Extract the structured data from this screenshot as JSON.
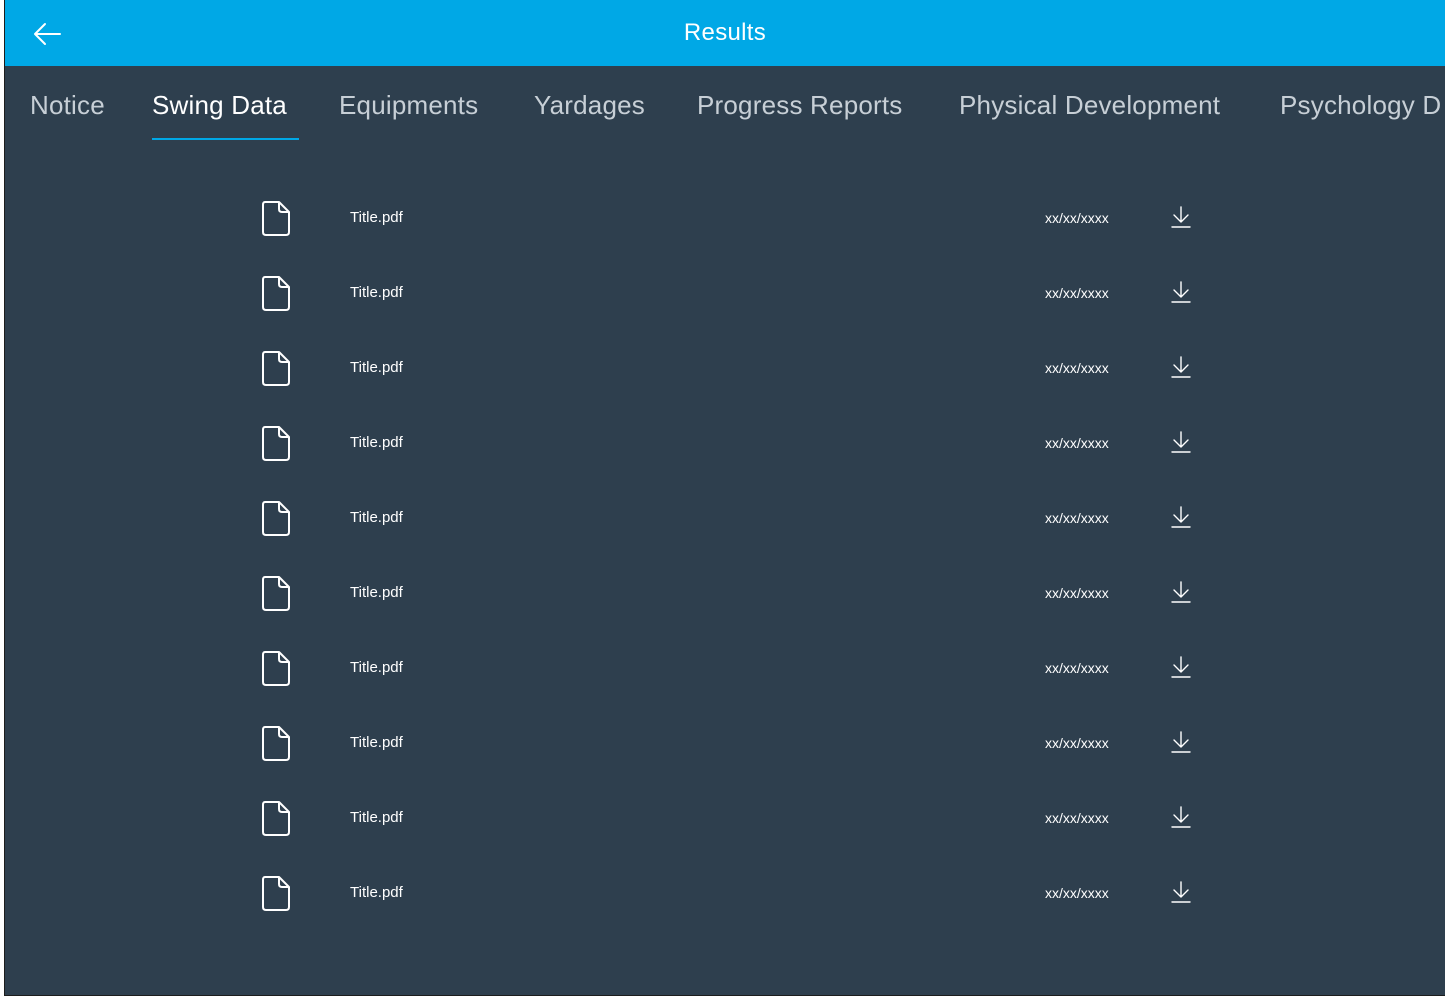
{
  "header": {
    "title": "Results",
    "back_icon": "arrow-left-icon",
    "background": "#00a8e6"
  },
  "tabs": [
    {
      "label": "Notice",
      "active": false
    },
    {
      "label": "Swing Data",
      "active": true
    },
    {
      "label": "Equipments",
      "active": false
    },
    {
      "label": "Yardages",
      "active": false
    },
    {
      "label": "Progress Reports",
      "active": false
    },
    {
      "label": "Physical Development",
      "active": false
    },
    {
      "label": "Psychology D",
      "active": false
    }
  ],
  "files": [
    {
      "name": "Title.pdf",
      "date": "xx/xx/xxxx"
    },
    {
      "name": "Title.pdf",
      "date": "xx/xx/xxxx"
    },
    {
      "name": "Title.pdf",
      "date": "xx/xx/xxxx"
    },
    {
      "name": "Title.pdf",
      "date": "xx/xx/xxxx"
    },
    {
      "name": "Title.pdf",
      "date": "xx/xx/xxxx"
    },
    {
      "name": "Title.pdf",
      "date": "xx/xx/xxxx"
    },
    {
      "name": "Title.pdf",
      "date": "xx/xx/xxxx"
    },
    {
      "name": "Title.pdf",
      "date": "xx/xx/xxxx"
    },
    {
      "name": "Title.pdf",
      "date": "xx/xx/xxxx"
    },
    {
      "name": "Title.pdf",
      "date": "xx/xx/xxxx"
    }
  ],
  "icons": {
    "file": "file-icon",
    "download": "download-icon"
  },
  "colors": {
    "content_background": "#2e3f4e",
    "accent": "#00a8e6"
  }
}
